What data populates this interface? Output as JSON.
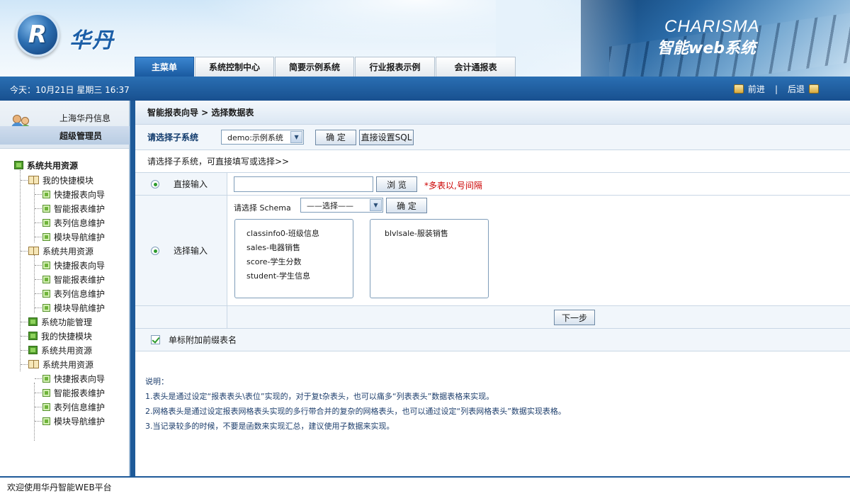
{
  "header": {
    "logo_letter": "R",
    "logo_text": "华丹",
    "brand_en": "CHARISMA",
    "brand_cn": "智能web系统"
  },
  "tabs": [
    {
      "label": "主菜单",
      "active": true
    },
    {
      "label": "系统控制中心",
      "active": false
    },
    {
      "label": "简要示例系统",
      "active": false
    },
    {
      "label": "行业报表示例",
      "active": false
    },
    {
      "label": "会计通报表",
      "active": false
    }
  ],
  "bar": {
    "datetime": "今天：10月21日 星期三 16:37",
    "forward": "前进",
    "separator": "|",
    "back": "后退"
  },
  "user": {
    "company": "上海华丹信息",
    "role": "超级管理员"
  },
  "tree": [
    {
      "label": "系统共用资源",
      "icon": "green",
      "bold": true
    },
    {
      "label": "我的快捷模块",
      "icon": "book"
    },
    {
      "label": "快捷报表向导",
      "icon": "leaf"
    },
    {
      "label": "智能报表维护",
      "icon": "leaf"
    },
    {
      "label": "表列信息维护",
      "icon": "leaf"
    },
    {
      "label": "模块导航维护",
      "icon": "leaf"
    },
    {
      "label": "系统共用资源",
      "icon": "book"
    },
    {
      "label": "快捷报表向导",
      "icon": "leaf"
    },
    {
      "label": "智能报表维护",
      "icon": "leaf"
    },
    {
      "label": "表列信息维护",
      "icon": "leaf"
    },
    {
      "label": "模块导航维护",
      "icon": "leaf"
    },
    {
      "label": "系统功能管理",
      "icon": "green"
    },
    {
      "label": "我的快捷模块",
      "icon": "green"
    },
    {
      "label": "系统共用资源",
      "icon": "green"
    },
    {
      "label": "系统共用资源",
      "icon": "book"
    },
    {
      "label": "快捷报表向导",
      "icon": "leaf"
    },
    {
      "label": "智能报表维护",
      "icon": "leaf"
    },
    {
      "label": "表列信息维护",
      "icon": "leaf"
    },
    {
      "label": "模块导航维护",
      "icon": "leaf"
    }
  ],
  "main": {
    "breadcrumb": "智能报表向导 > 选择数据表",
    "subsystem_label": "请选择子系统",
    "subsystem_value": "demo:示例系统",
    "confirm_label": "确 定",
    "direct_sql_label": "直接设置SQL",
    "hint": "请选择子系统，可直接填写或选择>>",
    "direct_input_label": "直接输入",
    "browse_label": "浏 览",
    "direct_note": "*多表以,号间隔",
    "select_input_label": "选择输入",
    "schema_label": "请选择 Schema",
    "schema_value": "——选择——",
    "schema_confirm_label": "确 定",
    "list_left": [
      "classinfo0-班级信息",
      "sales-电器销售",
      "score-学生分数",
      "student-学生信息"
    ],
    "list_right": [
      "blvlsale-服装销售"
    ],
    "next_label": "下一步",
    "suffix_label": "单标附加前缀表名",
    "notes_title": "说明：",
    "notes": [
      "1.表头是通过设定“报表表头\\表位”实现的，对于复t杂表头，也可以痛多“列表表头”数据表格来实现。",
      "2.网格表头是通过设定报表网格表头实现的多行带合并的复杂的网格表头，也可以通过设定“列表网格表头”数据实现表格。",
      "3.当记录较多的时候，不要是函数来实现汇总，建议使用子数据来实现。"
    ]
  },
  "footer": {
    "text": "欢迎使用华丹智能WEB平台"
  },
  "colors": {
    "accent_blue": "#1e5a99",
    "tab_active": "#2a74c0",
    "note_red": "#cc0000"
  }
}
